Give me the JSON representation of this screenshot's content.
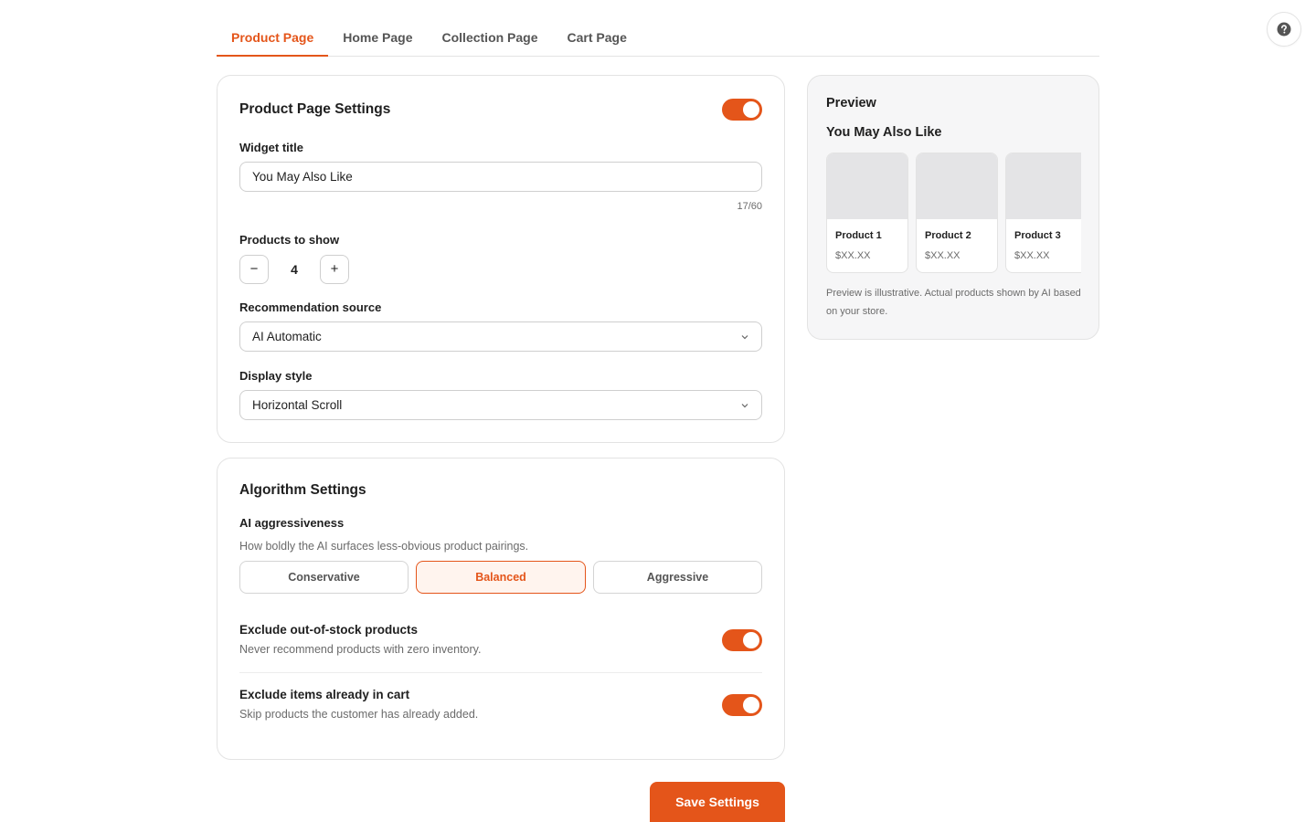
{
  "tabs": [
    {
      "label": "Product Page",
      "active": true
    },
    {
      "label": "Home Page",
      "active": false
    },
    {
      "label": "Collection Page",
      "active": false
    },
    {
      "label": "Cart Page",
      "active": false
    }
  ],
  "colors": {
    "accent": "#e4551a",
    "accent_bg": "#fff4ee"
  },
  "product_settings": {
    "title": "Product Page Settings",
    "enabled": true,
    "widget_title_label": "Widget title",
    "widget_title_value": "You May Also Like",
    "widget_title_counter": "17/60",
    "products_to_show_label": "Products to show",
    "products_to_show_minus": "−",
    "products_to_show_value": "4",
    "products_to_show_plus": "+",
    "recommendation_source_label": "Recommendation source",
    "recommendation_source_value": "AI Automatic",
    "display_style_label": "Display style",
    "display_style_value": "Horizontal Scroll"
  },
  "algorithm_settings": {
    "title": "Algorithm Settings",
    "aggressiveness_label": "AI aggressiveness",
    "aggressiveness_desc": "How boldly the AI surfaces less-obvious product pairings.",
    "options": [
      "Conservative",
      "Balanced",
      "Aggressive"
    ],
    "selected_option": "Balanced",
    "exclude_oos_title": "Exclude out-of-stock products",
    "exclude_oos_desc": "Never recommend products with zero inventory.",
    "exclude_oos_enabled": true,
    "exclude_cart_title": "Exclude items already in cart",
    "exclude_cart_desc": "Skip products the customer has already added.",
    "exclude_cart_enabled": true
  },
  "preview": {
    "label": "Preview",
    "widget_title": "You May Also Like",
    "products": [
      {
        "name": "Product 1",
        "price": "$XX.XX"
      },
      {
        "name": "Product 2",
        "price": "$XX.XX"
      },
      {
        "name": "Product 3",
        "price": "$XX.XX"
      }
    ],
    "note": "Preview is illustrative. Actual products shown by AI based on your store."
  },
  "save_label": "Save Settings",
  "icons": {
    "help": "question-circle-icon",
    "chevron": "chevron-down-icon"
  }
}
